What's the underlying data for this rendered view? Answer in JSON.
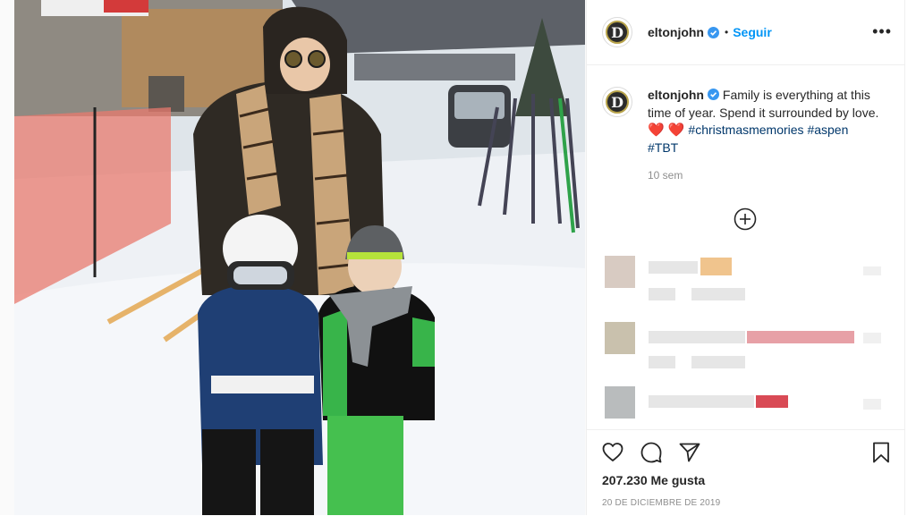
{
  "post": {
    "username": "eltonjohn",
    "dot": "•",
    "follow_label": "Seguir",
    "more_label": "•••",
    "avatar_letter": "D"
  },
  "caption": {
    "username": "eltonjohn",
    "text": "Family is everything at this time of year. Spend it surrounded by love.",
    "hearts": "❤️ ❤️",
    "hashtags": [
      "#christmasmemories",
      "#aspen",
      "#TBT"
    ],
    "time_ago": "10 sem"
  },
  "actions": {
    "likes": "207.230 Me gusta",
    "date": "20 DE DICIEMBRE DE 2019"
  },
  "colors": {
    "follow": "#0095f6",
    "hashtag": "#00376b",
    "heart": "#ed4956",
    "verified": "#3897f0",
    "muted": "#8e8e8e"
  },
  "icons": {
    "verified": "verified-badge-icon",
    "load_more": "plus-circle-icon",
    "like": "heart-outline-icon",
    "comment": "comment-bubble-icon",
    "share": "paper-plane-icon",
    "save": "bookmark-icon",
    "more": "ellipsis-icon"
  }
}
